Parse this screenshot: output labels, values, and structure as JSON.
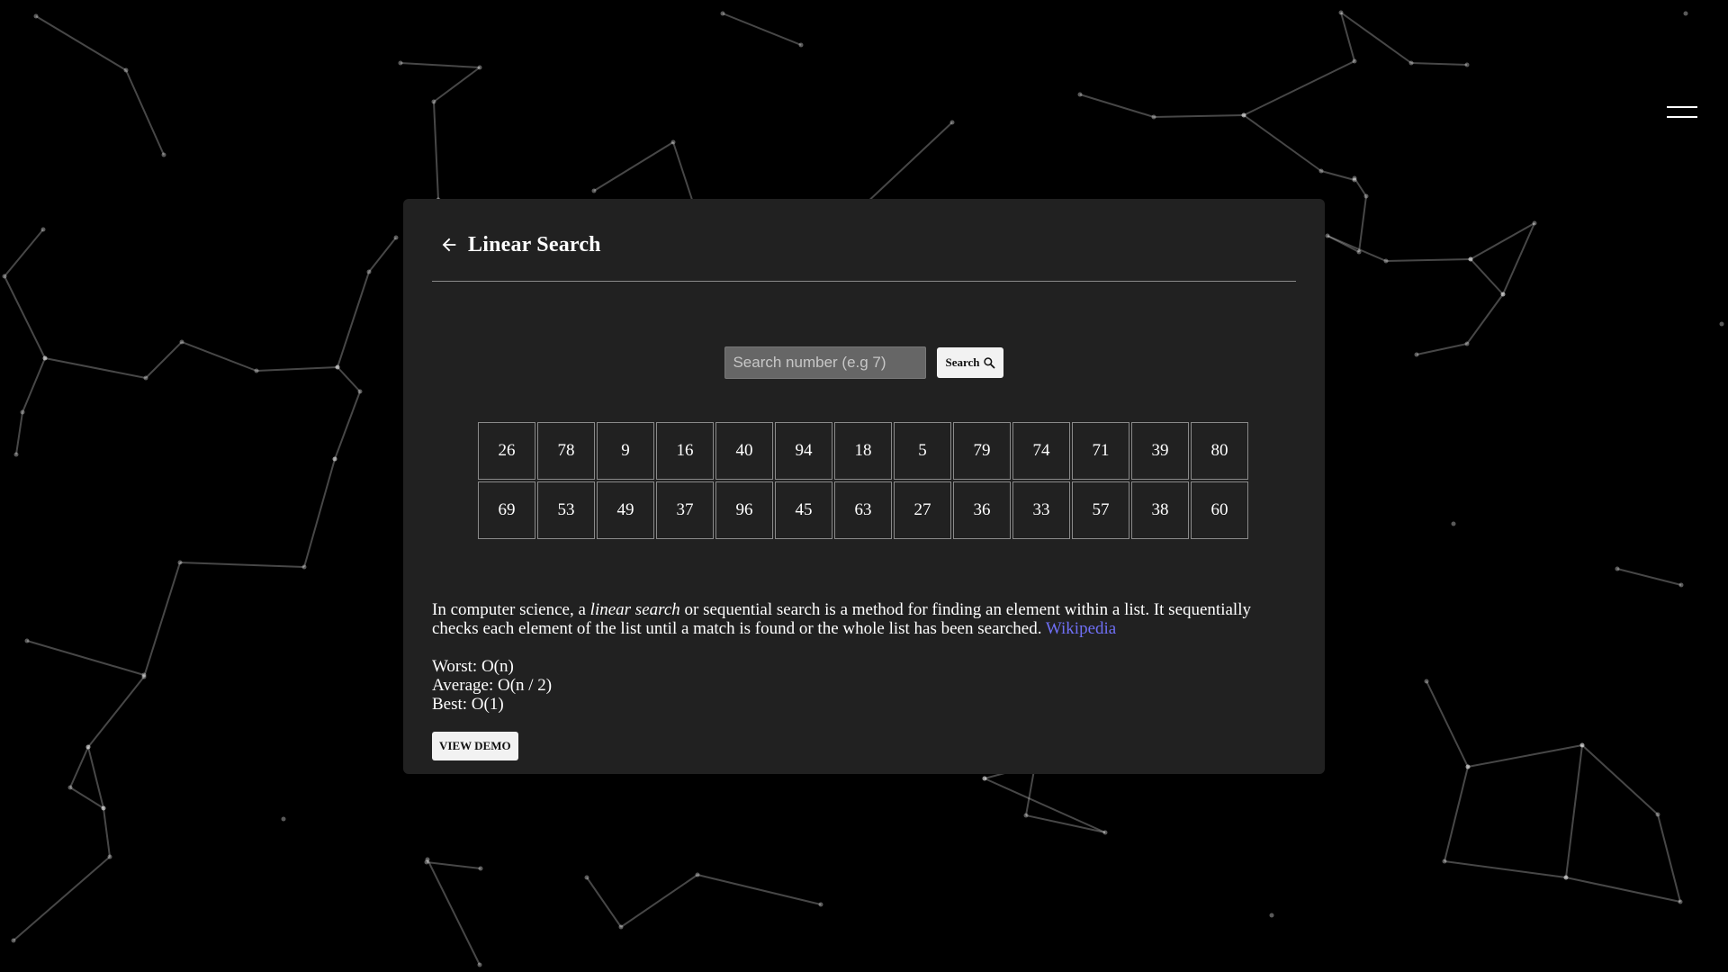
{
  "header": {
    "title": "Linear Search",
    "back_icon": "arrow-left-icon"
  },
  "menu": {
    "icon": "hamburger-menu-icon"
  },
  "search": {
    "placeholder": "Search number (e.g 7)",
    "value": "",
    "button_label": "Search",
    "button_icon": "magnifier-icon"
  },
  "numbers": [
    26,
    78,
    9,
    16,
    40,
    94,
    18,
    5,
    79,
    74,
    71,
    39,
    80,
    69,
    53,
    49,
    37,
    96,
    45,
    63,
    27,
    36,
    33,
    57,
    38,
    60
  ],
  "description": {
    "prefix": "In computer science, a ",
    "emphasis": "linear search",
    "suffix": " or sequential search is a method for finding an element within a list. It sequentially checks each element of the list until a match is found or the whole list has been searched. ",
    "link_label": "Wikipedia"
  },
  "complexity": {
    "worst": "Worst: O(n)",
    "average": "Average: O(n / 2)",
    "best": "Best: O(1)"
  },
  "demo_button_label": "VIEW DEMO",
  "colors": {
    "background": "#000000",
    "card": "#212121",
    "link": "#6f6ff5",
    "input": "#666666"
  }
}
